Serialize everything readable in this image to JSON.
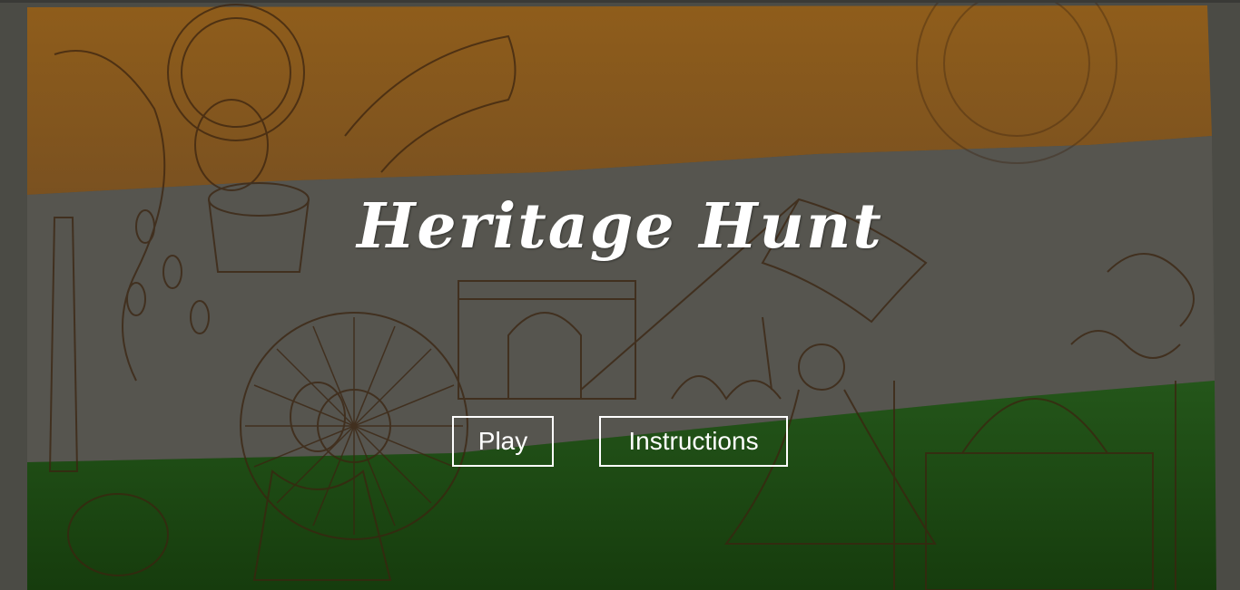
{
  "game": {
    "title": "Heritage Hunt"
  },
  "menu": {
    "play_label": "Play",
    "instructions_label": "Instructions"
  },
  "background": {
    "theme": "indian-heritage-tricolor-illustration",
    "colors": {
      "saffron": "#8a5a1c",
      "white_band": "#56554f",
      "green": "#1f4a12",
      "frame": "#4b4b45",
      "line_art": "#3b2410"
    }
  }
}
